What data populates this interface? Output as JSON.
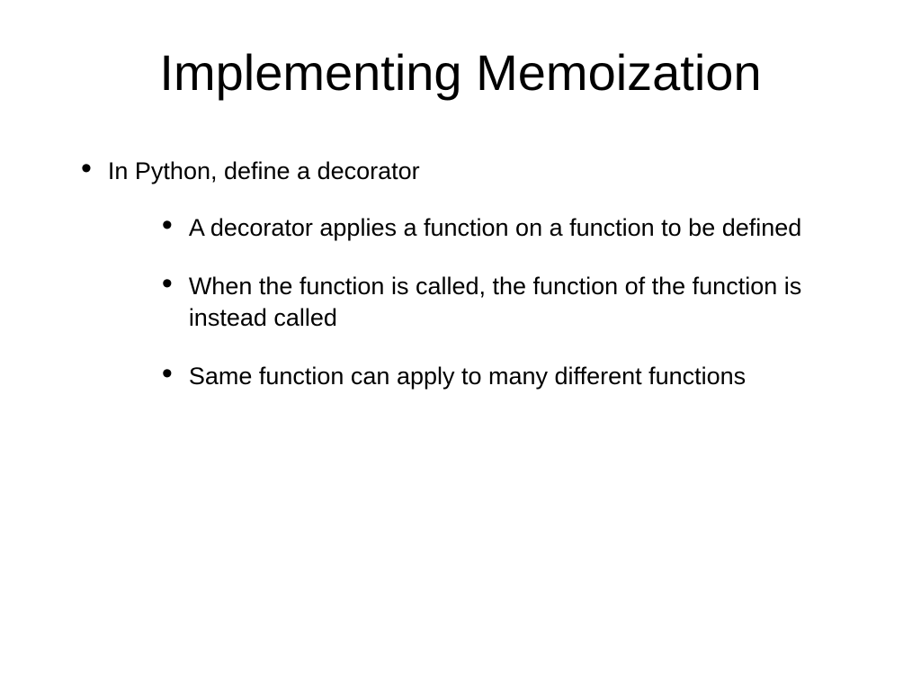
{
  "slide": {
    "title": "Implementing Memoization",
    "bullets": [
      {
        "text": "In Python, define a decorator",
        "sub": [
          "A decorator applies a function on a function to be defined",
          "When the function is called, the function of the function is instead called",
          "Same function can apply to many different functions"
        ]
      }
    ]
  }
}
